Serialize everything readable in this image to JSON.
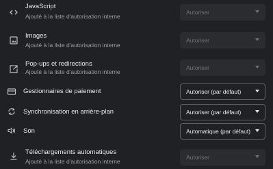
{
  "settings": [
    {
      "title": "JavaScript",
      "subtitle": "Ajouté à la liste d'autorisation interne",
      "icon": "code-icon",
      "value": "Autoriser",
      "enabled": false
    },
    {
      "title": "Images",
      "subtitle": "Ajouté à la liste d'autorisation interne",
      "icon": "image-icon",
      "value": "Autoriser",
      "enabled": false
    },
    {
      "title": "Pop-ups et redirections",
      "subtitle": "Ajouté à la liste d'autorisation interne",
      "icon": "open-in-new-icon",
      "value": "Autoriser",
      "enabled": false
    },
    {
      "title": "Gestionnaires de paiement",
      "icon": "credit-card-icon",
      "value": "Autoriser (par défaut)",
      "enabled": true
    },
    {
      "title": "Synchronisation en arrière-plan",
      "icon": "sync-icon",
      "value": "Autoriser (par défaut)",
      "enabled": true
    },
    {
      "title": "Son",
      "icon": "volume-icon",
      "value": "Automatique (par défaut)",
      "enabled": true
    },
    {
      "title": "Téléchargements automatiques",
      "subtitle": "Ajouté à la liste d'autorisation interne",
      "icon": "download-icon",
      "value": "Autoriser",
      "enabled": false
    }
  ],
  "colors": {
    "background": "#202124",
    "text": "#e8eaed",
    "muted": "#9aa0a6",
    "disabled_select": "#2b2c2f"
  }
}
